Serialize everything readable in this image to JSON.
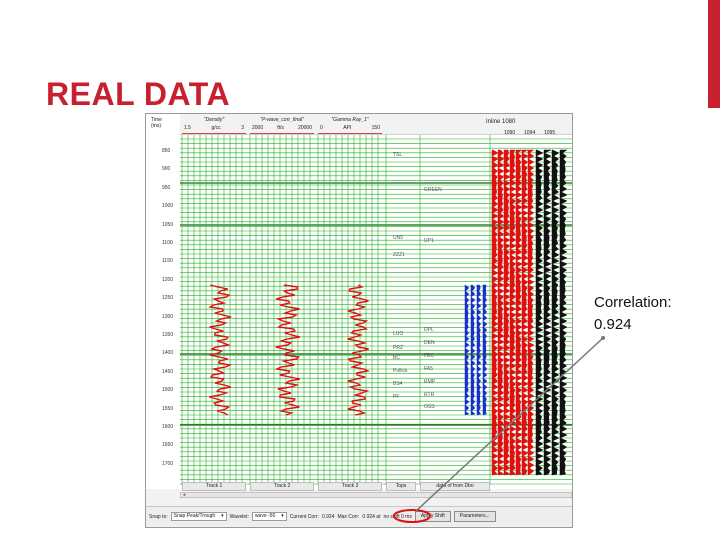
{
  "slide": {
    "title": "REAL DATA",
    "callout_line1": "Correlation:",
    "callout_line2": "0.924",
    "accent_color": "#c8202f"
  },
  "app": {
    "time_header_line1": "Time",
    "time_header_line2": "(ms)",
    "time_ticks": [
      "850",
      "900",
      "950",
      "1000",
      "1050",
      "1100",
      "1150",
      "1200",
      "1250",
      "1300",
      "1350",
      "1400",
      "1450",
      "1500",
      "1550",
      "1600",
      "1650",
      "1700"
    ],
    "tracks": [
      {
        "name": "\"Density\"",
        "scale_left": "1.5",
        "scale_mid": "g/cc",
        "scale_right": "3",
        "footer": "Track 1"
      },
      {
        "name": "\"P-wave_corr_final\"",
        "scale_left": "2000",
        "scale_mid": "ft/s",
        "scale_right": "20000",
        "footer": "Track 2"
      },
      {
        "name": "\"Gamma Ray_1\"",
        "scale_left": "0",
        "scale_mid": "API",
        "scale_right": "150",
        "footer": "Track 3"
      }
    ],
    "tops_footer": "Tops",
    "seismic_footer": "data  of  from Dbo",
    "inline_label": "Inline 1080",
    "trace_numbers": [
      "1090",
      "1094",
      "1095"
    ],
    "formation_labels": [
      {
        "text": "TSL"
      },
      {
        "text": "GREEN"
      },
      {
        "text": "UN5"
      },
      {
        "text": "UP1"
      },
      {
        "text": "ZZZ1"
      },
      {
        "text": "LUO"
      },
      {
        "text": "DPL"
      },
      {
        "text": "DEN"
      },
      {
        "text": "PRZ"
      },
      {
        "text": "FBC"
      },
      {
        "text": "BC"
      },
      {
        "text": "FA5"
      },
      {
        "text": "Pollick"
      },
      {
        "text": "RMP"
      },
      {
        "text": "BS4"
      },
      {
        "text": "RTR"
      },
      {
        "text": "PF"
      },
      {
        "text": "OSS"
      }
    ],
    "toolbar": {
      "snap_label": "Snap to:",
      "snap_value": "Snap Peak/Trough",
      "wavelet_label": "Wavelet:",
      "wavelet_value": "wave  -56",
      "current_corr_label": "Current Corr:",
      "current_corr_value": "0.924",
      "max_corr_label": "Max Corr:",
      "max_corr_value": "0.924 at",
      "shift_text": "no shift 0 ms",
      "apply_shift_label": "Apply Shift",
      "parameters_label": "Parameters..."
    },
    "grid_color": "#22b022",
    "log_color": "#e01010",
    "highlight_color": "#e01010"
  }
}
